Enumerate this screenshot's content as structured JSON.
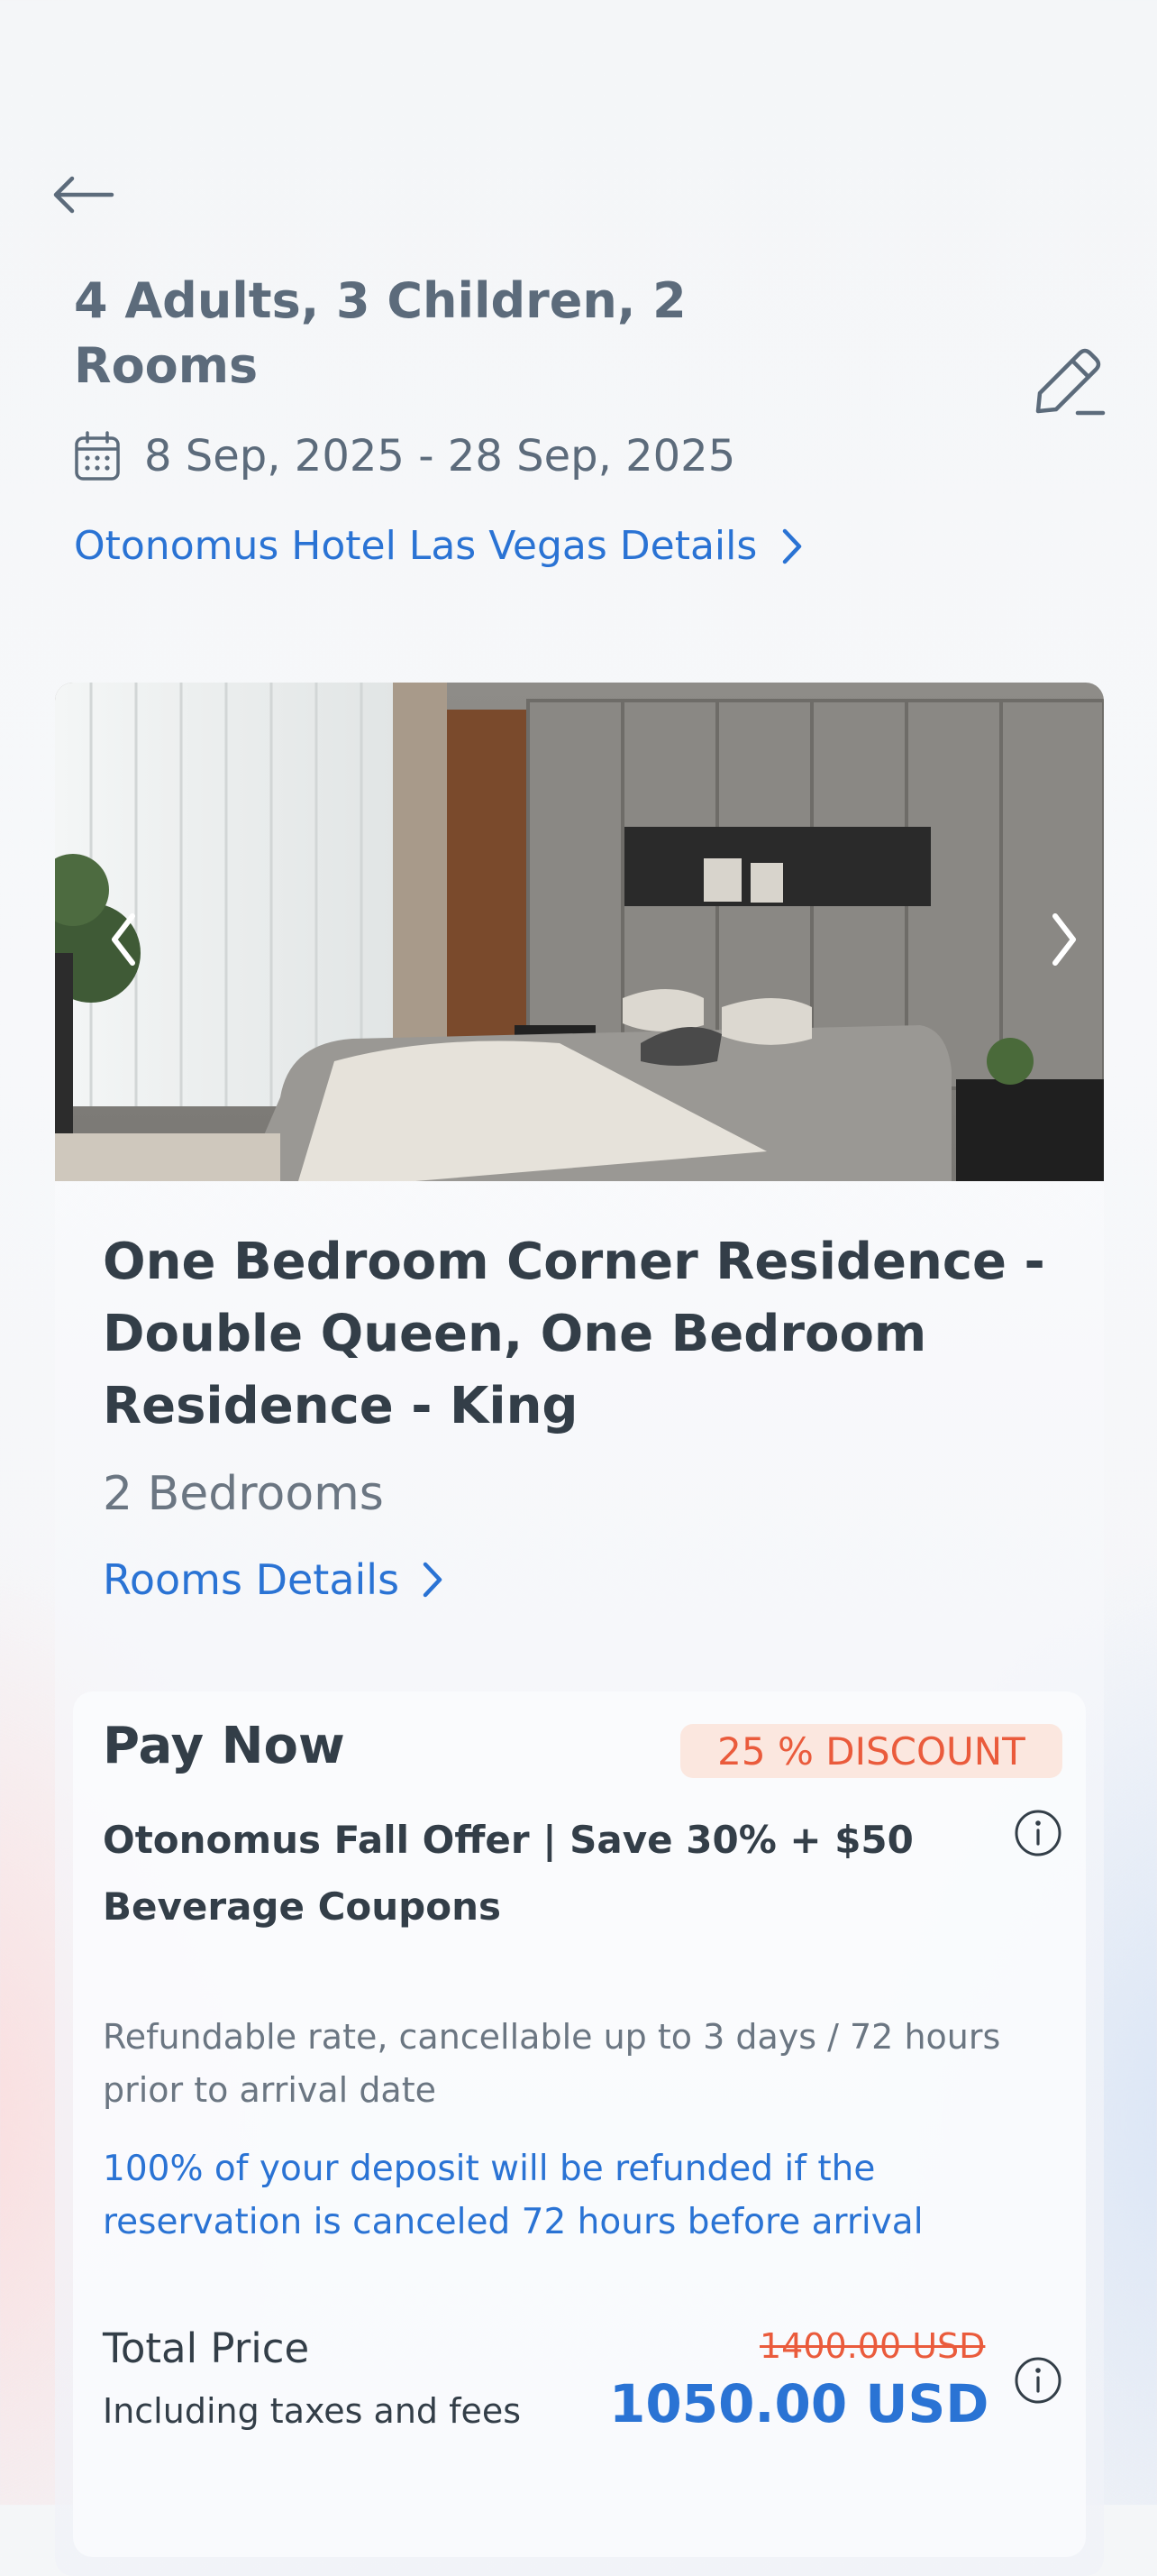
{
  "header": {
    "guests_rooms": "4 Adults, 3 Children, 2 Rooms",
    "date_range": "8 Sep, 2025 - 28 Sep, 2025",
    "hotel_link": "Otonomus Hotel Las Vegas Details"
  },
  "room": {
    "title": "One Bedroom Corner Residence - Double Queen, One Bedroom Residence - King",
    "bedrooms": "2 Bedrooms",
    "details_link": "Rooms Details"
  },
  "offer": {
    "pay_title": "Pay Now",
    "discount_badge": "25 % DISCOUNT",
    "offer_name": "Otonomus Fall Offer | Save 30% + $50 Beverage Coupons",
    "refund_policy": "Refundable rate, cancellable up to 3 days / 72 hours prior to arrival date",
    "deposit_note": "100% of your deposit will be refunded if the reservation is canceled 72 hours before arrival",
    "total_label": "Total Price",
    "tax_label": "Including taxes and fees",
    "original_price": "1400.00 USD",
    "final_price": "1050.00 USD"
  },
  "icons": {
    "back": "arrow-left-icon",
    "edit": "pencil-icon",
    "calendar": "calendar-icon",
    "chevron": "chevron-right-icon",
    "info": "info-icon"
  },
  "colors": {
    "accent": "#2a73d4",
    "discount": "#ea5b3c",
    "discount_bg": "#fbe7df",
    "heading": "#5c6b7b",
    "text": "#333e48"
  }
}
